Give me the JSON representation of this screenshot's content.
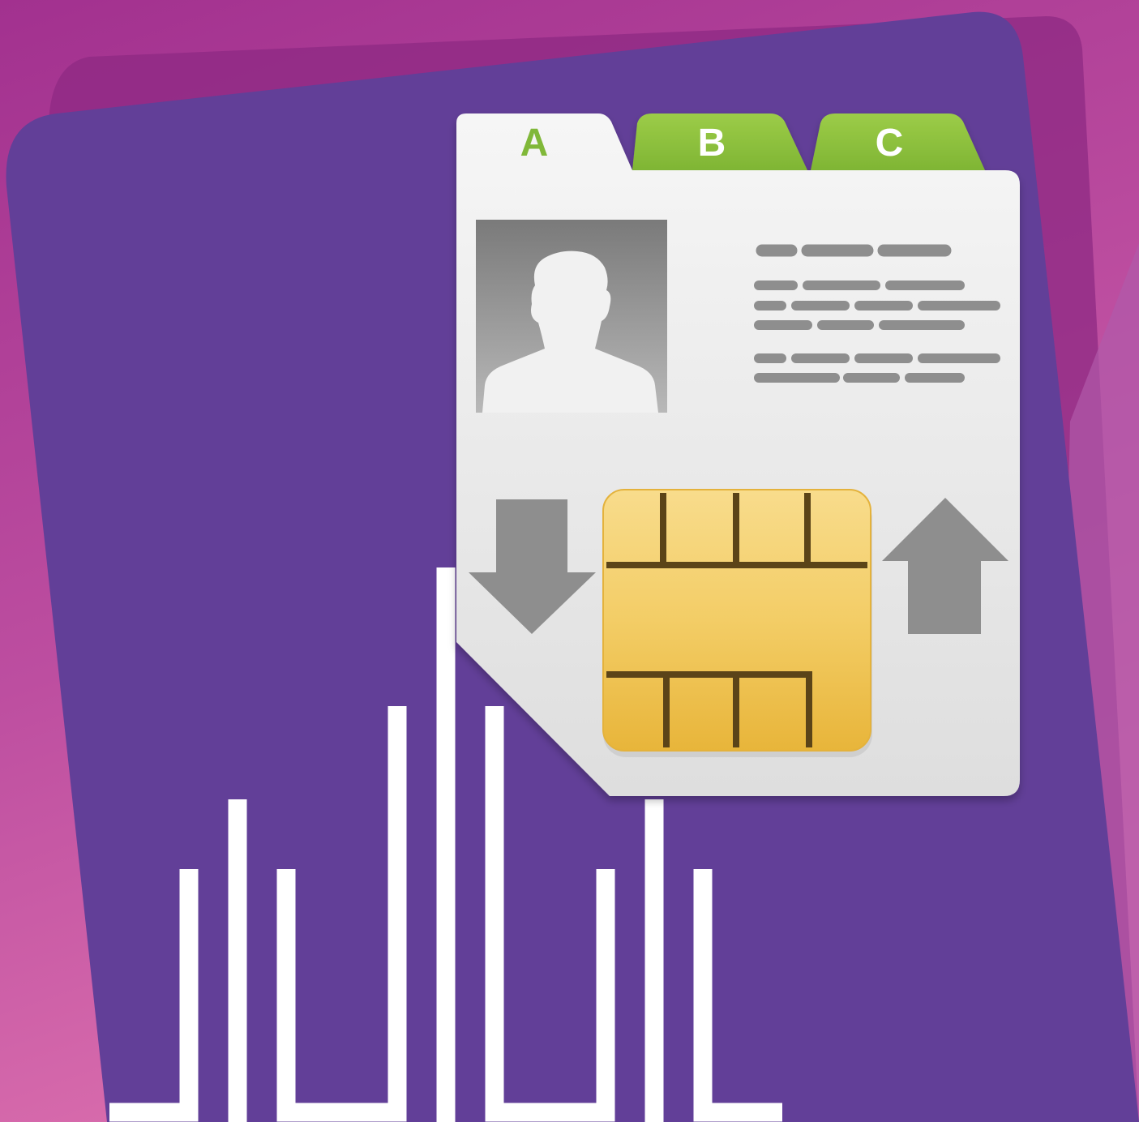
{
  "app_icon": {
    "tabs": [
      {
        "label": "A",
        "active": true
      },
      {
        "label": "B",
        "active": false
      },
      {
        "label": "C",
        "active": false
      }
    ],
    "icons": {
      "contact_photo": "person-silhouette-icon",
      "import": "arrow-down-icon",
      "sim": "sim-chip-icon",
      "export": "arrow-up-icon",
      "signal": "signal-bars-icon"
    },
    "colors": {
      "background_magenta": "#a2318f",
      "background_pink": "#d46aa8",
      "card_purple": "#623f98",
      "tab_green": "#8cbf3c",
      "tab_active_text": "#80b839",
      "page_light": "#efefef",
      "icon_gray": "#8e8e8e",
      "chip_gold": "#f1c65a",
      "chip_line": "#5b4418",
      "signal_white": "#ffffff"
    }
  }
}
